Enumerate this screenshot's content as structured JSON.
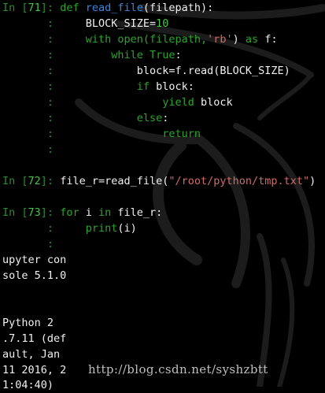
{
  "colors": {
    "background": "#000000",
    "prompt": "#2e8b2e",
    "prompt_number": "#45c545",
    "keyword": "#2aa52a",
    "function_name": "#3a83e6",
    "string": "#d06a6a",
    "text": "#f0f0f0"
  },
  "cells": [
    {
      "prompt_in": "In [",
      "prompt_num": "71",
      "prompt_close": "]:",
      "cont": ":",
      "lines": {
        "l1_def": "def",
        "l1_name": "read_file",
        "l1_rest": "(filepath):",
        "l2": "BLOCK_SIZE=",
        "l2_num": "10",
        "l3_with": "with",
        "l3_open": " open(filepath,",
        "l3_str": "'rb'",
        "l3_close": ")",
        "l3_as": "as",
        "l3_f": " f:",
        "l4_while": "while",
        "l4_true": "True",
        "l4_colon": ":",
        "l5": "block=f.read(BLOCK_SIZE)",
        "l6_if": "if",
        "l6_rest": " block:",
        "l7_yield": "yield",
        "l7_rest": " block",
        "l8_else": "else",
        "l8_colon": ":",
        "l9_return": "return"
      }
    },
    {
      "prompt_in": "In [",
      "prompt_num": "72",
      "prompt_close": "]:",
      "code_a": "file_r=read_file(",
      "code_str": "\"/root/python/tmp.txt\"",
      "code_b": ")"
    },
    {
      "prompt_in": "In [",
      "prompt_num": "73",
      "prompt_close": "]:",
      "cont": ":",
      "for": "for",
      "var": " i ",
      "in": "in",
      "iter": " file_r:",
      "print": "print",
      "print_args": "(i)"
    }
  ],
  "output_lines": [
    "upyter con",
    "sole 5.1.0",
    "Python 2",
    ".7.11 (def",
    "ault, Jan",
    "11 2016, 2",
    "1:04:40)"
  ],
  "watermark": "http://blog.csdn.net/syshzbtt"
}
